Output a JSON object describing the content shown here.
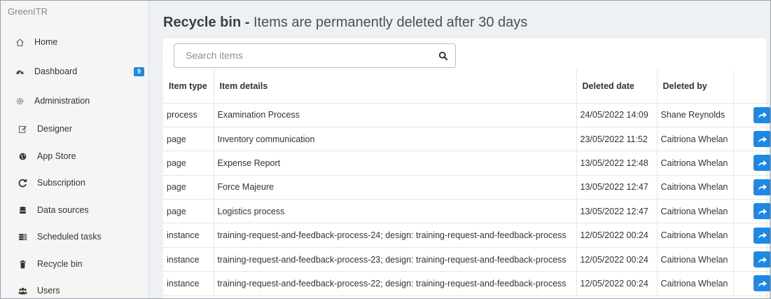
{
  "app": {
    "brand": "GreenITR"
  },
  "sidebar": {
    "items": [
      {
        "label": "Home",
        "icon": "home-icon"
      },
      {
        "label": "Dashboard",
        "icon": "dashboard-icon",
        "badge": "9"
      },
      {
        "label": "Administration",
        "icon": "gear-icon"
      },
      {
        "label": "Designer",
        "icon": "edit-icon"
      },
      {
        "label": "App Store",
        "icon": "globe-icon"
      },
      {
        "label": "Subscription",
        "icon": "refresh-icon"
      },
      {
        "label": "Data sources",
        "icon": "database-icon"
      },
      {
        "label": "Scheduled tasks",
        "icon": "tasks-icon"
      },
      {
        "label": "Recycle bin",
        "icon": "trash-icon"
      },
      {
        "label": "Users",
        "icon": "users-icon"
      }
    ]
  },
  "page": {
    "title": "Recycle bin -",
    "subtitle": "Items are permanently deleted after 30 days"
  },
  "search": {
    "placeholder": "Search items",
    "value": ""
  },
  "table": {
    "columns": [
      "Item type",
      "Item details",
      "Deleted date",
      "Deleted by",
      ""
    ],
    "rows": [
      {
        "type": "process",
        "details": "Examination Process",
        "date": "24/05/2022 14:09",
        "by": "Shane Reynolds"
      },
      {
        "type": "page",
        "details": "Inventory communication",
        "date": "23/05/2022 11:52",
        "by": "Caitriona Whelan"
      },
      {
        "type": "page",
        "details": "Expense Report",
        "date": "13/05/2022 12:48",
        "by": "Caitriona Whelan"
      },
      {
        "type": "page",
        "details": "Force Majeure",
        "date": "13/05/2022 12:47",
        "by": "Caitriona Whelan"
      },
      {
        "type": "page",
        "details": "Logistics process",
        "date": "13/05/2022 12:47",
        "by": "Caitriona Whelan"
      },
      {
        "type": "instance",
        "details": "training-request-and-feedback-process-24; design: training-request-and-feedback-process",
        "date": "12/05/2022 00:24",
        "by": "Caitriona Whelan"
      },
      {
        "type": "instance",
        "details": "training-request-and-feedback-process-23; design: training-request-and-feedback-process",
        "date": "12/05/2022 00:24",
        "by": "Caitriona Whelan"
      },
      {
        "type": "instance",
        "details": "training-request-and-feedback-process-22; design: training-request-and-feedback-process",
        "date": "12/05/2022 00:24",
        "by": "Caitriona Whelan"
      }
    ]
  },
  "colors": {
    "accent": "#1e88e5",
    "sidebar_bg": "#f5f5f5",
    "main_bg": "#eef1f4"
  }
}
